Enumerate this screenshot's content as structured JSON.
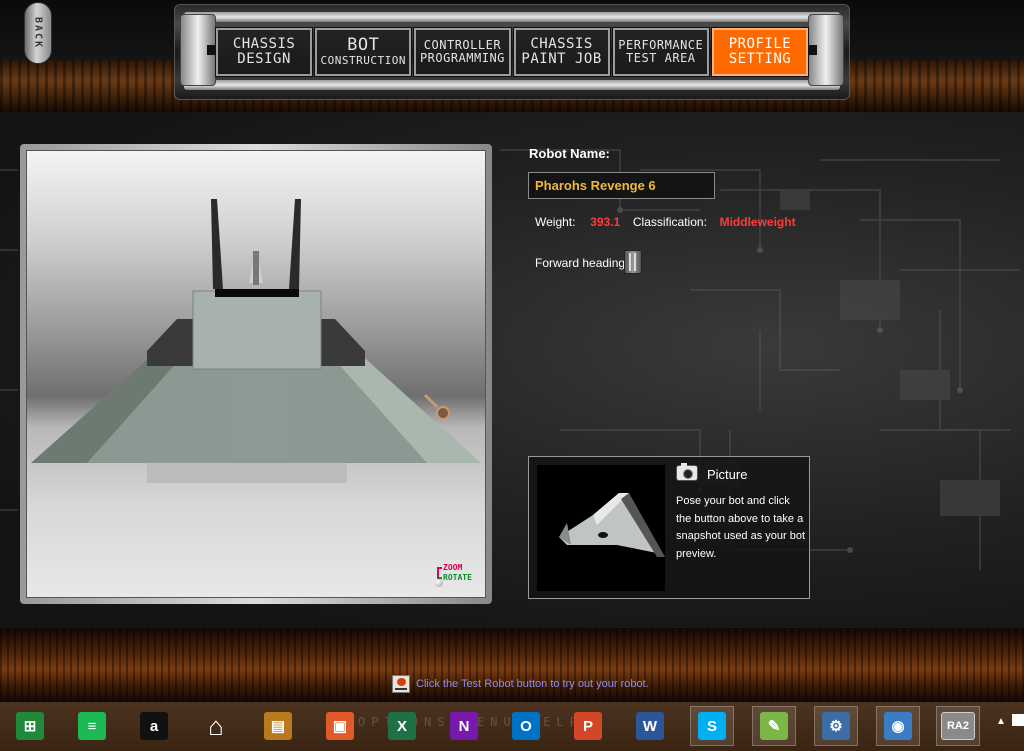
{
  "back_button": {
    "label": "BACK"
  },
  "nav": {
    "tabs": [
      {
        "line1": "CHASSIS",
        "line2": "DESIGN",
        "active": false
      },
      {
        "line1": "BOT",
        "line2": "CONSTRUCTION",
        "active": false
      },
      {
        "line1": "CONTROLLER",
        "line2": "PROGRAMMING",
        "active": false
      },
      {
        "line1": "CHASSIS",
        "line2": "PAINT JOB",
        "active": false
      },
      {
        "line1": "PERFORMANCE",
        "line2": "TEST AREA",
        "active": false
      },
      {
        "line1": "PROFILE",
        "line2": "SETTING",
        "active": true
      }
    ],
    "active_color": "#ff6a00"
  },
  "viewport": {
    "zoom_label": "ZOOM",
    "rotate_label": "ROTATE"
  },
  "profile": {
    "robot_name_label": "Robot Name:",
    "robot_name_value": "Pharohs Revenge 6",
    "weight_label": "Weight:",
    "weight_value": "393.1",
    "classification_label": "Classification:",
    "classification_value": "Middleweight",
    "forward_heading_label": "Forward heading:",
    "value_color": "#ff3b3b",
    "name_color": "#f0b93c"
  },
  "picture": {
    "title": "Picture",
    "description": "Pose your bot and click the button above to take a snapshot used as your bot preview.",
    "icon": "camera-icon"
  },
  "status_hint": {
    "text": "Click the Test Robot button to try out your robot."
  },
  "taskbar": {
    "ghost_text": "OPTIONS  MENU  HELP",
    "items": [
      {
        "name": "store",
        "glyph": "⊞",
        "color": "#1f8b3a"
      },
      {
        "name": "spotify",
        "glyph": "≡",
        "color": "#1db954"
      },
      {
        "name": "amazon",
        "glyph": "a",
        "color": "#111111"
      },
      {
        "name": "home",
        "glyph": "⌂",
        "color": "#ffffff"
      },
      {
        "name": "notes",
        "glyph": "▤",
        "color": "#b87a1a"
      },
      {
        "name": "photos",
        "glyph": "▣",
        "color": "#e05a2a"
      },
      {
        "name": "excel",
        "glyph": "X",
        "color": "#1e7145"
      },
      {
        "name": "onenote",
        "glyph": "N",
        "color": "#7719aa"
      },
      {
        "name": "outlook",
        "glyph": "O",
        "color": "#0072c6"
      },
      {
        "name": "powerpoint",
        "glyph": "P",
        "color": "#d24726"
      },
      {
        "name": "word",
        "glyph": "W",
        "color": "#2b579a"
      },
      {
        "name": "skype",
        "glyph": "S",
        "color": "#00aff0"
      },
      {
        "name": "editor",
        "glyph": "✎",
        "color": "#7ab648"
      },
      {
        "name": "network-tool",
        "glyph": "⚙",
        "color": "#3a6ea5"
      },
      {
        "name": "browser",
        "glyph": "◉",
        "color": "#3b7dc4"
      },
      {
        "name": "ra2",
        "glyph": "RA2",
        "color": "#8a8a8a"
      }
    ]
  }
}
